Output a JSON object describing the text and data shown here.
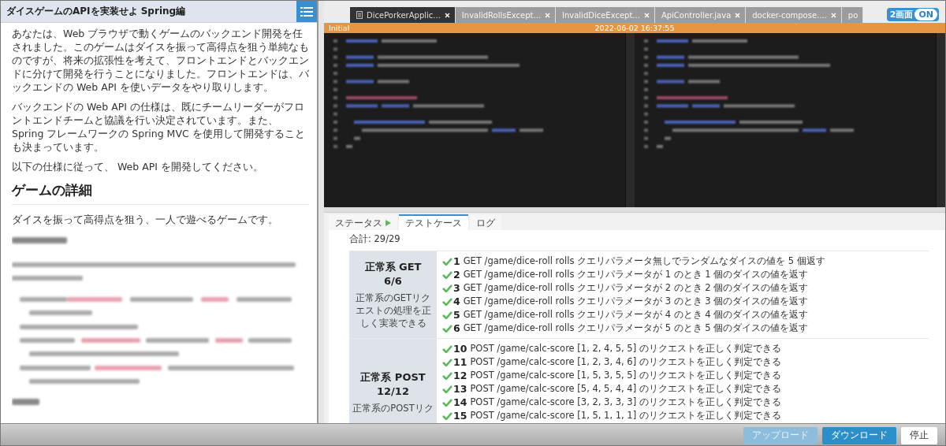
{
  "doc": {
    "title": "ダイスゲームのAPIを実装せよ Spring編",
    "paragraphs": [
      "あなたは、Web ブラウザで動くゲームのバックエンド開発を任されました。このゲームはダイスを振って高得点を狙う単純なものですが、将来の拡張性を考えて、フロントエンドとバックエンドに分けて開発を行うことになりました。フロントエンドは、バックエンドの Web API を使いデータをやり取りします。",
      "バックエンドの Web API の仕様は、既にチームリーダーがフロントエンドチームと協議を行い決定されています。また、 Spring フレームワークの Spring MVC を使用して開発することも決まっています。",
      "以下の仕様に従って、 Web API を開発してください。"
    ],
    "heading": "ゲームの詳細",
    "summary": "ダイスを振って高得点を狙う、一人で遊べるゲームです。"
  },
  "editor": {
    "tabs": [
      {
        "label": "DicePorkerApplic...",
        "selected": true
      },
      {
        "label": "InvalidRollsExcept...",
        "selected": false
      },
      {
        "label": "InvalidDiceExcept...",
        "selected": false
      },
      {
        "label": "ApiController.java",
        "selected": false
      },
      {
        "label": "docker-compose....",
        "selected": false
      },
      {
        "label": "po",
        "selected": false
      }
    ],
    "dual_view": {
      "label": "2画面",
      "state": "ON",
      "on": true
    },
    "status": {
      "label": "Initial",
      "timestamp": "2022-06-02 16:37:55"
    }
  },
  "results": {
    "tabs": [
      {
        "label": "ステータス",
        "selected": false,
        "running": true
      },
      {
        "label": "テストケース",
        "selected": true,
        "running": false
      },
      {
        "label": "ログ",
        "selected": false,
        "running": false
      }
    ],
    "total": "合計: 29/29",
    "groups": [
      {
        "title": "正常系 GET",
        "score": "6/6",
        "description": "正常系のGETリクエストの処理を正しく実装できる",
        "cases": [
          {
            "number": "1",
            "passed": true,
            "text": "GET /game/dice-roll rolls クエリパラメータ無しでランダムなダイスの値を 5 個返す"
          },
          {
            "number": "2",
            "passed": true,
            "text": "GET /game/dice-roll rolls クエリパラメータが 1 のとき 1 個のダイスの値を返す"
          },
          {
            "number": "3",
            "passed": true,
            "text": "GET /game/dice-roll rolls クエリパラメータが 2 のとき 2 個のダイスの値を返す"
          },
          {
            "number": "4",
            "passed": true,
            "text": "GET /game/dice-roll rolls クエリパラメータが 3 のとき 3 個のダイスの値を返す"
          },
          {
            "number": "5",
            "passed": true,
            "text": "GET /game/dice-roll rolls クエリパラメータが 4 のとき 4 個のダイスの値を返す"
          },
          {
            "number": "6",
            "passed": true,
            "text": "GET /game/dice-roll rolls クエリパラメータが 5 のとき 5 個のダイスの値を返す"
          }
        ]
      },
      {
        "title": "正常系 POST",
        "score": "12/12",
        "description": "正常系のPOSTリク",
        "cases": [
          {
            "number": "10",
            "passed": true,
            "text": "POST /game/calc-score [1, 2, 4, 5, 5] のリクエストを正しく判定できる"
          },
          {
            "number": "11",
            "passed": true,
            "text": "POST /game/calc-score [1, 2, 3, 4, 6] のリクエストを正しく判定できる"
          },
          {
            "number": "12",
            "passed": true,
            "text": "POST /game/calc-score [1, 5, 3, 5, 5] のリクエストを正しく判定できる"
          },
          {
            "number": "13",
            "passed": true,
            "text": "POST /game/calc-score [5, 4, 5, 4, 4] のリクエストを正しく判定できる"
          },
          {
            "number": "14",
            "passed": true,
            "text": "POST /game/calc-score [3, 2, 3, 3, 3] のリクエストを正しく判定できる"
          },
          {
            "number": "15",
            "passed": true,
            "text": "POST /game/calc-score [1, 5, 1, 1, 1] のリクエストを正しく判定できる"
          }
        ]
      }
    ]
  },
  "actions": [
    {
      "label": "アップロード",
      "kind": "primary",
      "disabled": true
    },
    {
      "label": "ダウンロード",
      "kind": "primary",
      "disabled": false
    },
    {
      "label": "停止",
      "kind": "plain",
      "disabled": false
    }
  ]
}
